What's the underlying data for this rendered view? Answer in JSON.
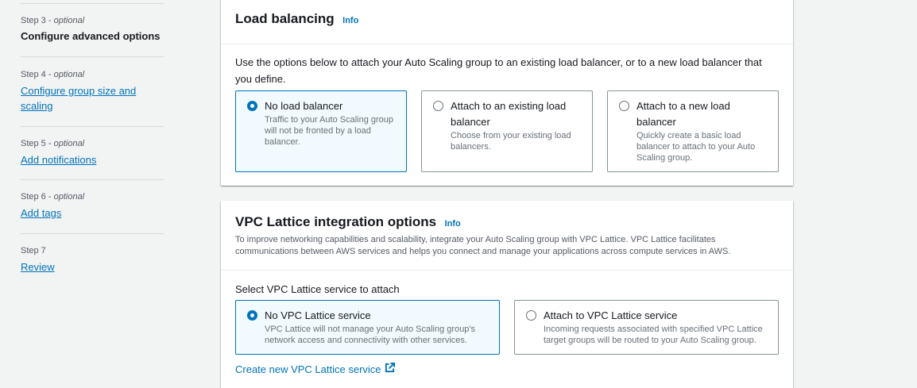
{
  "sidebar": {
    "steps": [
      {
        "label": "Step 3",
        "optional": "optional",
        "title": "Configure advanced options"
      },
      {
        "label": "Step 4",
        "optional": "optional",
        "title": "Configure group size and scaling"
      },
      {
        "label": "Step 5",
        "optional": "optional",
        "title": "Add notifications"
      },
      {
        "label": "Step 6",
        "optional": "optional",
        "title": "Add tags"
      },
      {
        "label": "Step 7",
        "title": "Review"
      }
    ],
    "separator": " - "
  },
  "load_balancing": {
    "title": "Load balancing",
    "info": "Info",
    "description": "Use the options below to attach your Auto Scaling group to an existing load balancer, or to a new load balancer that you define.",
    "options": [
      {
        "title": "No load balancer",
        "desc": "Traffic to your Auto Scaling group will not be fronted by a load balancer.",
        "selected": true
      },
      {
        "title": "Attach to an existing load balancer",
        "desc": "Choose from your existing load balancers.",
        "selected": false
      },
      {
        "title": "Attach to a new load balancer",
        "desc": "Quickly create a basic load balancer to attach to your Auto Scaling group.",
        "selected": false
      }
    ]
  },
  "vpc_lattice": {
    "title": "VPC Lattice integration options",
    "info": "Info",
    "description": "To improve networking capabilities and scalability, integrate your Auto Scaling group with VPC Lattice. VPC Lattice facilitates communications between AWS services and helps you connect and manage your applications across compute services in AWS.",
    "select_label": "Select VPC Lattice service to attach",
    "options": [
      {
        "title": "No VPC Lattice service",
        "desc": "VPC Lattice will not manage your Auto Scaling group's network access and connectivity with other services.",
        "selected": true
      },
      {
        "title": "Attach to VPC Lattice service",
        "desc": "Incoming requests associated with specified VPC Lattice target groups will be routed to your Auto Scaling group.",
        "selected": false
      }
    ],
    "create_link": "Create new VPC Lattice service",
    "create_link_icon": "external-link-icon"
  },
  "colors": {
    "accent": "#0073bb",
    "selected_bg": "#f1faff",
    "page_bg": "#f2f3f3"
  }
}
